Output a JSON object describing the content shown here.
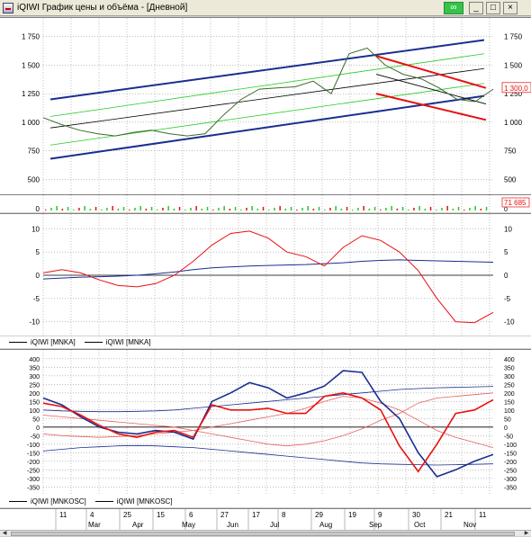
{
  "window": {
    "title": "iQIWI График цены и объёма - [Дневной]",
    "link_icon": "link-icon",
    "min_label": "_",
    "max_label": "□",
    "close_label": "×"
  },
  "colors": {
    "blue": "#1a2e8f",
    "red": "#e81010",
    "green": "#22cc22",
    "black": "#000000",
    "thin_red": "#e86060"
  },
  "price_panel": {
    "y_ticks": [
      "1 750",
      "1 500",
      "1 250",
      "1 000",
      "750",
      "500"
    ],
    "y_values": [
      1750,
      1500,
      1250,
      1000,
      750,
      500
    ],
    "ylim": [
      400,
      1850
    ],
    "price_label": "1 300,0"
  },
  "volume_panel": {
    "y_tick": "0",
    "volume_label": "71 685",
    "right_tick": "0"
  },
  "mnka_panel": {
    "y_ticks": [
      "10",
      "5",
      "0",
      "-5",
      "-10"
    ],
    "y_values": [
      10,
      5,
      0,
      -5,
      -10
    ],
    "ylim": [
      -12,
      12
    ],
    "legend": [
      "iQIWI [MNKA]",
      "iQIWI [MNKA]"
    ]
  },
  "osc_panel": {
    "y_ticks": [
      "400",
      "350",
      "300",
      "250",
      "200",
      "150",
      "100",
      "50",
      "0",
      "-50",
      "-100",
      "-150",
      "-200",
      "-250",
      "-300",
      "-350"
    ],
    "y_values": [
      400,
      350,
      300,
      250,
      200,
      150,
      100,
      50,
      0,
      -50,
      -100,
      -150,
      -200,
      -250,
      -300,
      -350
    ],
    "ylim": [
      -380,
      420
    ],
    "legend": [
      "iQIWI [MNKOSC]",
      "iQIWI [MNKOSC]"
    ]
  },
  "x_axis": {
    "day_labels": [
      "11",
      "4",
      "25",
      "15",
      "6",
      "27",
      "17",
      "8",
      "29",
      "19",
      "9",
      "30",
      "21",
      "11"
    ],
    "month_labels": [
      "Mar",
      "Apr",
      "May",
      "Jun",
      "Jul",
      "Aug",
      "Sep",
      "Oct",
      "Nov"
    ]
  },
  "chart_data": [
    {
      "type": "line",
      "title": "",
      "series": [
        {
          "values": [
            1040,
            980,
            930,
            900,
            880,
            910,
            930,
            900,
            880,
            900,
            1060,
            1200,
            1290,
            1300,
            1310,
            1360,
            1250,
            1600,
            1650,
            1500,
            1420,
            1380,
            1300,
            1200,
            1180,
            1290
          ]
        }
      ],
      "ylim": [
        400,
        1850
      ]
    },
    {
      "type": "line",
      "title": "",
      "series": [
        {
          "values": [
            0.5,
            1.2,
            0.5,
            -1.0,
            -2.2,
            -2.5,
            -1.8,
            0.0,
            3.0,
            6.5,
            9.0,
            9.5,
            8.0,
            5.0,
            4.0,
            2.0,
            6.0,
            8.5,
            7.5,
            5.0,
            1.0,
            -5.0,
            -10.0,
            -10.2,
            -8.0
          ]
        },
        {
          "values": [
            -0.8,
            -0.6,
            -0.4,
            -0.3,
            -0.2,
            0.0,
            0.3,
            0.7,
            1.2,
            1.6,
            1.8,
            2.0,
            2.1,
            2.2,
            2.3,
            2.5,
            2.7,
            3.0,
            3.2,
            3.3,
            3.2,
            3.1,
            3.0,
            2.9,
            2.8
          ]
        }
      ],
      "ylim": [
        -12,
        12
      ]
    },
    {
      "type": "line",
      "title": "",
      "series": [
        {
          "values": [
            170,
            130,
            60,
            0,
            -30,
            -40,
            -20,
            -30,
            -70,
            150,
            200,
            260,
            230,
            170,
            200,
            240,
            330,
            320,
            150,
            50,
            -150,
            -290,
            -250,
            -200,
            -160
          ]
        },
        {
          "values": [
            140,
            120,
            70,
            10,
            -40,
            -60,
            -30,
            -20,
            -60,
            130,
            100,
            100,
            110,
            80,
            80,
            180,
            200,
            170,
            100,
            -110,
            -260,
            -100,
            80,
            100,
            160
          ]
        }
      ],
      "ylim": [
        -380,
        420
      ]
    }
  ]
}
